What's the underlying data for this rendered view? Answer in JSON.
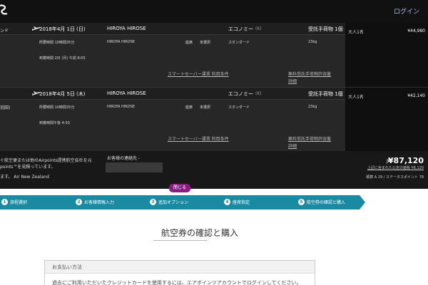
{
  "header": {
    "login": "ログイン"
  },
  "flights": [
    {
      "left_route": "ンド",
      "date": "2018年4月 1日 (日)",
      "passenger": "HIROYA HIROSE",
      "cabin": "エコノミー",
      "cabin_code": "(K)",
      "baggage_title": "受託手荷物 1個",
      "duration": "所要時間 10時間35分",
      "passenger_small": "HIROYA HIROSE",
      "seat_label": "座席",
      "seat_value": "未選択",
      "fare": "スタンダード",
      "weight": "23kg",
      "arrival": "到着時間 2日 (月) 午前 8:05",
      "link_fare": "スマートセーバー運賃 利用条件",
      "link_bag_1": "無料受託手荷物許容量",
      "link_bag_2": "詳細",
      "fare_type": "大人1名",
      "price": "¥44,980"
    },
    {
      "left_route": "羽田)",
      "date": "2018年4月 5日 (木)",
      "passenger": "HIROYA HIROSE",
      "cabin": "エコノミー",
      "cabin_code": "(K)",
      "baggage_title": "受託手荷物 1個",
      "duration": "所要時間 10時間35分",
      "passenger_small": "HIROYA HIROSE",
      "seat_label": "座席",
      "seat_value": "未選択",
      "fare": "スタンダード",
      "weight": "23kg",
      "arrival": "到着時間午後 4:50",
      "link_fare": "スマートセーバー運賃 利用条件",
      "link_bag_1": "無料受託手荷物許容量",
      "link_bag_2": "詳細",
      "fare_type": "大人1名",
      "price": "¥42,140"
    }
  ],
  "summary": {
    "left_line_1": "ぐ航空便または他のAirpoints提携航空会社を元",
    "left_line_2": "points™を見積っています。",
    "left_line_3": "ます。 Air New Zealand",
    "contact_label": "お客様の連絡先 -",
    "currency": "JPY",
    "total": "¥87,120",
    "tax_note": "上記に含まれた公定の諸税 ¥8,120",
    "points_note": "積算 A 29 / ステータスポイント 78",
    "close": "閉じる"
  },
  "steps": [
    {
      "num": "1",
      "label": "旅程選択"
    },
    {
      "num": "2",
      "label": "お客様情報入力"
    },
    {
      "num": "3",
      "label": "追加オプション"
    },
    {
      "num": "4",
      "label": "座席指定"
    },
    {
      "num": "5",
      "label": "航空券の確認と購入"
    }
  ],
  "main": {
    "title": "航空券の確認と購入",
    "payment_header": "お支払い方法",
    "payment_text": "過去にご利用いただいたクレジットカードを使用するには、エアポインツアカウントでログインしてください。"
  },
  "colors": {
    "steps_bar": "#1a8aa3",
    "close_tab": "#8a1d85",
    "login_link": "#9ec3ea"
  }
}
